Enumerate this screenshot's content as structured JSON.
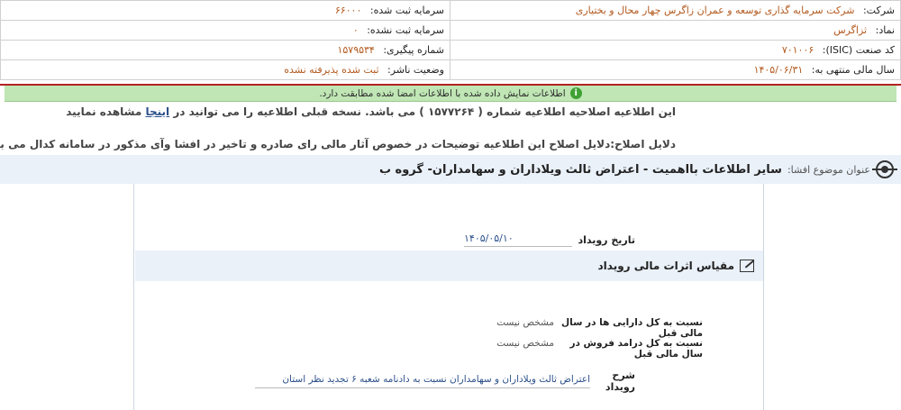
{
  "company": {
    "company_label": "شرکت:",
    "company_value": "شرکت سرمایه گذاری توسعه و عمران زاگرس چهار محال و بختیاری",
    "registered_capital_label": "سرمایه ثبت شده:",
    "registered_capital_value": "۶۶۰۰۰",
    "symbol_label": "نماد:",
    "symbol_value": "ثزاگرس",
    "unregistered_capital_label": "سرمایه ثبت نشده:",
    "unregistered_capital_value": "۰",
    "isic_label": "کد صنعت (ISIC):",
    "isic_value": "۷۰۱۰۰۶",
    "tracking_label": "شماره پیگیری:",
    "tracking_value": "۱۵۷۹۵۳۴",
    "fiscal_year_label": "سال مالی منتهی به:",
    "fiscal_year_value": "۱۴۰۵/۰۶/۳۱",
    "publisher_status_label": "وضعیت ناشر:",
    "publisher_status_value": "ثبت شده پذیرفته نشده"
  },
  "success_message": "اطلاعات نمایش داده شده با اطلاعات امضا شده مطابقت دارد.",
  "notice": {
    "text_before": "این اطلاعیه اصلاحیه اطلاعیه شماره ( ۱۵۷۷۲۶۴ ) می باشد. نسخه قبلی اطلاعیه را می توانید در",
    "link": "اینجا",
    "text_after": "مشاهده نمایید"
  },
  "correction_reason": "دلایل اصلاح:دلایل اصلاح این اطلاعیه توضیحات در خصوص آثار مالی رای صادره و تاخیر در افشا وآی مذکور در سامانه کدال می باشد.",
  "subject": {
    "label": "عنوان موضوع افشا:",
    "value": "سایر اطلاعات بااهمیت - اعتراض ثالث ویلاداران و سهامداران- گروه ب"
  },
  "event": {
    "date_label": "تاریخ رویداد",
    "date_value": "۱۴۰۵/۰۵/۱۰"
  },
  "financial_section": {
    "title": "مقیاس اثرات مالی رویداد",
    "rows": [
      {
        "label": "نسبت به کل دارایی ها در سال مالی قبل",
        "value": "مشخص نیست"
      },
      {
        "label": "نسبت به کل درامد فروش در سال مالی قبل",
        "value": "مشخص نیست"
      }
    ]
  },
  "description": {
    "label": "شرح رویداد",
    "value": "اعتراض ثالث ویلاداران و سهامداران نسبت به دادنامه شعبه ۶ تجدید نظر استان"
  },
  "colors": {
    "accent_value": "#b35a1f",
    "link_blue": "#2b4f8a",
    "success_bg": "#bfe6b4",
    "header_line": "#b22222",
    "section_bg": "#eaf1f9"
  }
}
